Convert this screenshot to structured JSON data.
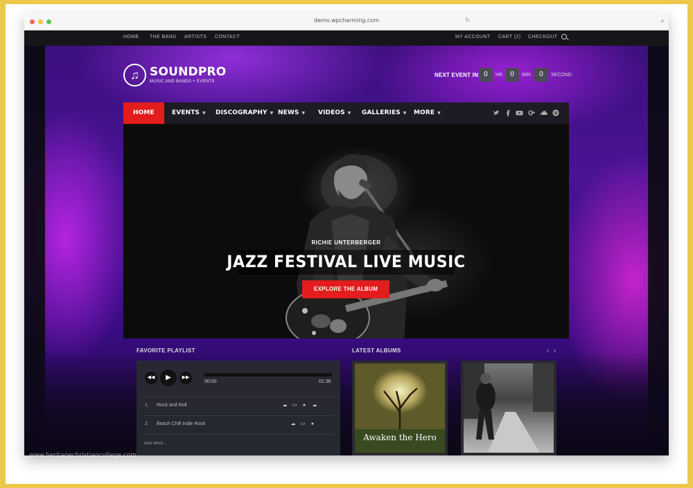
{
  "browser": {
    "url": "demo.wpcharming.com"
  },
  "topbar": {
    "left_links": [
      "HOME",
      "THE BAND",
      "ARTISTS",
      "CONTACT"
    ],
    "right_links": [
      "MY ACCOUNT",
      "CART (2)",
      "CHECKOUT"
    ]
  },
  "logo": {
    "title": "SOUNDPRO",
    "subtitle": "MUSIC AND BANDS + EVENTS",
    "icon": "music-note-icon"
  },
  "countdown": {
    "label": "NEXT EVENT IN:",
    "hours": "0",
    "hr_label": "HR",
    "minutes": "0",
    "min_label": "MIN",
    "seconds": "0",
    "sec_label": "SECOND"
  },
  "nav": {
    "items": [
      "HOME",
      "EVENTS",
      "DISCOGRAPHY",
      "NEWS",
      "VIDEOS",
      "GALLERIES",
      "MORE"
    ],
    "active": "HOME",
    "social_icons": [
      "twitter-icon",
      "facebook-icon",
      "youtube-icon",
      "google-plus-icon",
      "soundcloud-icon",
      "spotify-icon"
    ]
  },
  "hero": {
    "subtitle": "RICHIE UNTERBERGER",
    "title": "JAZZ FESTIVAL LIVE MUSIC",
    "button": "EXPLORE THE ALBUM"
  },
  "playlist": {
    "title": "FAVORITE PLAYLIST",
    "current_time": "00:00",
    "duration": "01:36",
    "tracks": [
      {
        "num": "1.",
        "name": "Rock and Roll"
      },
      {
        "num": "2.",
        "name": "Beach Chill Indie Rock"
      }
    ],
    "view_more": "View More..."
  },
  "albums": {
    "title": "LATEST ALBUMS",
    "items": [
      {
        "caption": "Awaken the Hero"
      },
      {
        "caption": ""
      }
    ]
  },
  "watermark": "www.heritagechristiancollege.com",
  "colors": {
    "accent": "#e31d1d",
    "nav_bg": "#1c1c20",
    "frame": "#ecc94a"
  }
}
